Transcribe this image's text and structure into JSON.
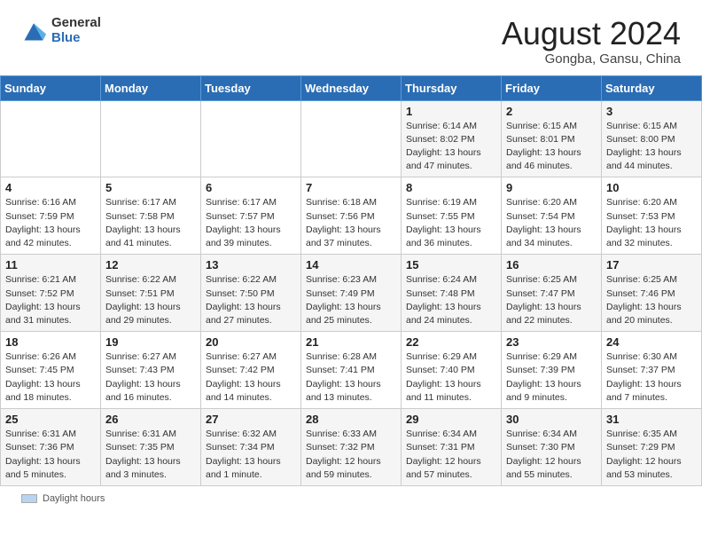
{
  "header": {
    "logo_general": "General",
    "logo_blue": "Blue",
    "month_year": "August 2024",
    "location": "Gongba, Gansu, China"
  },
  "calendar": {
    "days_of_week": [
      "Sunday",
      "Monday",
      "Tuesday",
      "Wednesday",
      "Thursday",
      "Friday",
      "Saturday"
    ],
    "weeks": [
      [
        {
          "day": "",
          "info": ""
        },
        {
          "day": "",
          "info": ""
        },
        {
          "day": "",
          "info": ""
        },
        {
          "day": "",
          "info": ""
        },
        {
          "day": "1",
          "info": "Sunrise: 6:14 AM\nSunset: 8:02 PM\nDaylight: 13 hours and 47 minutes."
        },
        {
          "day": "2",
          "info": "Sunrise: 6:15 AM\nSunset: 8:01 PM\nDaylight: 13 hours and 46 minutes."
        },
        {
          "day": "3",
          "info": "Sunrise: 6:15 AM\nSunset: 8:00 PM\nDaylight: 13 hours and 44 minutes."
        }
      ],
      [
        {
          "day": "4",
          "info": "Sunrise: 6:16 AM\nSunset: 7:59 PM\nDaylight: 13 hours and 42 minutes."
        },
        {
          "day": "5",
          "info": "Sunrise: 6:17 AM\nSunset: 7:58 PM\nDaylight: 13 hours and 41 minutes."
        },
        {
          "day": "6",
          "info": "Sunrise: 6:17 AM\nSunset: 7:57 PM\nDaylight: 13 hours and 39 minutes."
        },
        {
          "day": "7",
          "info": "Sunrise: 6:18 AM\nSunset: 7:56 PM\nDaylight: 13 hours and 37 minutes."
        },
        {
          "day": "8",
          "info": "Sunrise: 6:19 AM\nSunset: 7:55 PM\nDaylight: 13 hours and 36 minutes."
        },
        {
          "day": "9",
          "info": "Sunrise: 6:20 AM\nSunset: 7:54 PM\nDaylight: 13 hours and 34 minutes."
        },
        {
          "day": "10",
          "info": "Sunrise: 6:20 AM\nSunset: 7:53 PM\nDaylight: 13 hours and 32 minutes."
        }
      ],
      [
        {
          "day": "11",
          "info": "Sunrise: 6:21 AM\nSunset: 7:52 PM\nDaylight: 13 hours and 31 minutes."
        },
        {
          "day": "12",
          "info": "Sunrise: 6:22 AM\nSunset: 7:51 PM\nDaylight: 13 hours and 29 minutes."
        },
        {
          "day": "13",
          "info": "Sunrise: 6:22 AM\nSunset: 7:50 PM\nDaylight: 13 hours and 27 minutes."
        },
        {
          "day": "14",
          "info": "Sunrise: 6:23 AM\nSunset: 7:49 PM\nDaylight: 13 hours and 25 minutes."
        },
        {
          "day": "15",
          "info": "Sunrise: 6:24 AM\nSunset: 7:48 PM\nDaylight: 13 hours and 24 minutes."
        },
        {
          "day": "16",
          "info": "Sunrise: 6:25 AM\nSunset: 7:47 PM\nDaylight: 13 hours and 22 minutes."
        },
        {
          "day": "17",
          "info": "Sunrise: 6:25 AM\nSunset: 7:46 PM\nDaylight: 13 hours and 20 minutes."
        }
      ],
      [
        {
          "day": "18",
          "info": "Sunrise: 6:26 AM\nSunset: 7:45 PM\nDaylight: 13 hours and 18 minutes."
        },
        {
          "day": "19",
          "info": "Sunrise: 6:27 AM\nSunset: 7:43 PM\nDaylight: 13 hours and 16 minutes."
        },
        {
          "day": "20",
          "info": "Sunrise: 6:27 AM\nSunset: 7:42 PM\nDaylight: 13 hours and 14 minutes."
        },
        {
          "day": "21",
          "info": "Sunrise: 6:28 AM\nSunset: 7:41 PM\nDaylight: 13 hours and 13 minutes."
        },
        {
          "day": "22",
          "info": "Sunrise: 6:29 AM\nSunset: 7:40 PM\nDaylight: 13 hours and 11 minutes."
        },
        {
          "day": "23",
          "info": "Sunrise: 6:29 AM\nSunset: 7:39 PM\nDaylight: 13 hours and 9 minutes."
        },
        {
          "day": "24",
          "info": "Sunrise: 6:30 AM\nSunset: 7:37 PM\nDaylight: 13 hours and 7 minutes."
        }
      ],
      [
        {
          "day": "25",
          "info": "Sunrise: 6:31 AM\nSunset: 7:36 PM\nDaylight: 13 hours and 5 minutes."
        },
        {
          "day": "26",
          "info": "Sunrise: 6:31 AM\nSunset: 7:35 PM\nDaylight: 13 hours and 3 minutes."
        },
        {
          "day": "27",
          "info": "Sunrise: 6:32 AM\nSunset: 7:34 PM\nDaylight: 13 hours and 1 minute."
        },
        {
          "day": "28",
          "info": "Sunrise: 6:33 AM\nSunset: 7:32 PM\nDaylight: 12 hours and 59 minutes."
        },
        {
          "day": "29",
          "info": "Sunrise: 6:34 AM\nSunset: 7:31 PM\nDaylight: 12 hours and 57 minutes."
        },
        {
          "day": "30",
          "info": "Sunrise: 6:34 AM\nSunset: 7:30 PM\nDaylight: 12 hours and 55 minutes."
        },
        {
          "day": "31",
          "info": "Sunrise: 6:35 AM\nSunset: 7:29 PM\nDaylight: 12 hours and 53 minutes."
        }
      ]
    ]
  },
  "footer": {
    "daylight_label": "Daylight hours"
  }
}
